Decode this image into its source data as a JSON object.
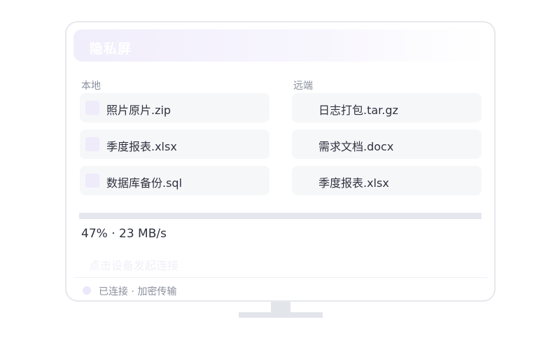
{
  "window": {
    "title": "隐私屏"
  },
  "local": {
    "label": "本地",
    "files": [
      "照片原片.zip",
      "季度报表.xlsx",
      "数据库备份.sql"
    ]
  },
  "remote": {
    "label": "远端",
    "files": [
      "日志打包.tar.gz",
      "需求文档.docx",
      "季度报表.xlsx"
    ]
  },
  "transfer": {
    "progress_percent": 47,
    "progress_text": "47% · 23 MB/s"
  },
  "connect_hint": "点击设备发起连接",
  "status": {
    "text": "已连接 · 加密传输"
  },
  "colors": {
    "accent_light": "#f1eefc",
    "card_bg": "#f6f7f9",
    "track": "#e4e8ee",
    "muted_text": "#8a8f9c"
  }
}
